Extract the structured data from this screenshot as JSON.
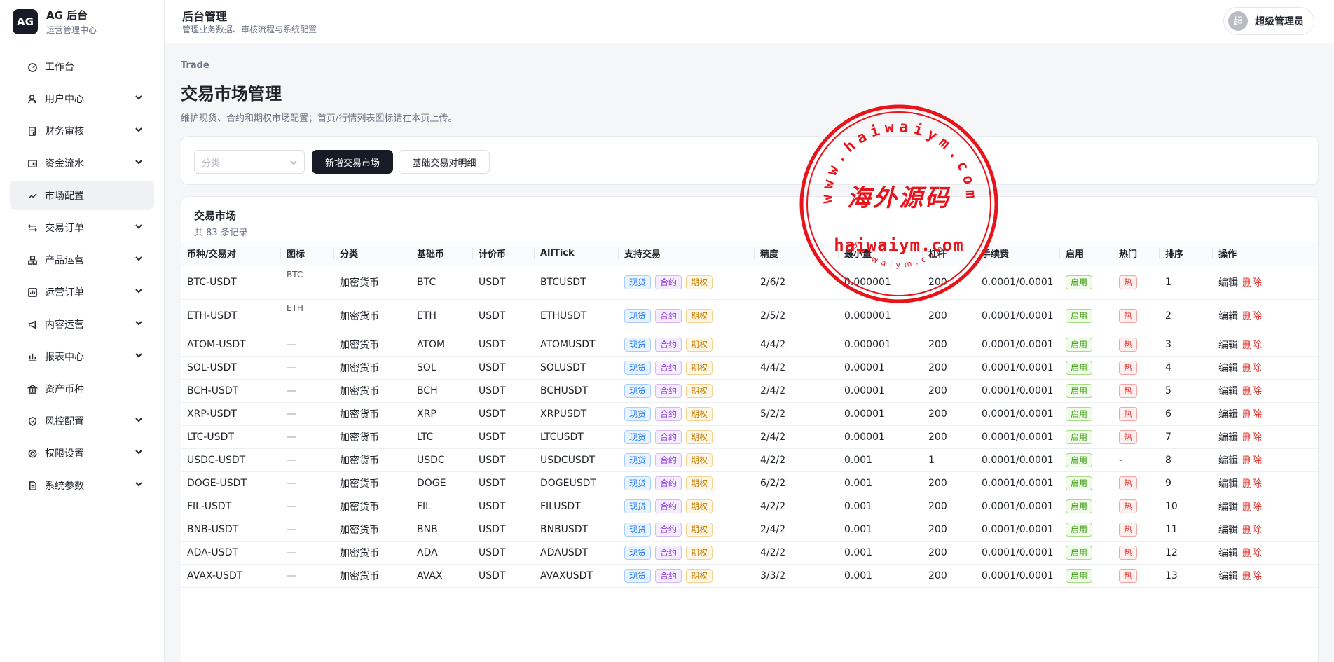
{
  "brand": {
    "logo": "AG",
    "title": "AG 后台",
    "subtitle": "运营管理中心"
  },
  "sidebar": {
    "items": [
      {
        "label": "工作台",
        "icon": "dashboard-icon",
        "expandable": false,
        "active": false
      },
      {
        "label": "用户中心",
        "icon": "user-icon",
        "expandable": true,
        "active": false
      },
      {
        "label": "财务审核",
        "icon": "audit-icon",
        "expandable": true,
        "active": false
      },
      {
        "label": "资金流水",
        "icon": "wallet-icon",
        "expandable": true,
        "active": false
      },
      {
        "label": "市场配置",
        "icon": "chart-line-icon",
        "expandable": false,
        "active": true
      },
      {
        "label": "交易订单",
        "icon": "swap-icon",
        "expandable": true,
        "active": false
      },
      {
        "label": "产品运营",
        "icon": "product-icon",
        "expandable": true,
        "active": false
      },
      {
        "label": "运营订单",
        "icon": "order-icon",
        "expandable": true,
        "active": false
      },
      {
        "label": "内容运营",
        "icon": "megaphone-icon",
        "expandable": true,
        "active": false
      },
      {
        "label": "报表中心",
        "icon": "bar-chart-icon",
        "expandable": true,
        "active": false
      },
      {
        "label": "资产币种",
        "icon": "bank-icon",
        "expandable": false,
        "active": false
      },
      {
        "label": "风控配置",
        "icon": "shield-icon",
        "expandable": true,
        "active": false
      },
      {
        "label": "权限设置",
        "icon": "gear-icon",
        "expandable": true,
        "active": false
      },
      {
        "label": "系统参数",
        "icon": "document-icon",
        "expandable": true,
        "active": false
      }
    ]
  },
  "topbar": {
    "title": "后台管理",
    "subtitle": "管理业务数据、审核流程与系统配置",
    "user_avatar": "超",
    "user_name": "超级管理员"
  },
  "page": {
    "eyebrow": "Trade",
    "title": "交易市场管理",
    "description": "维护现货、合约和期权市场配置；首页/行情列表图标请在本页上传。"
  },
  "filters": {
    "category_placeholder": "分类",
    "add_button": "新增交易市场",
    "pair_detail_button": "基础交易对明细"
  },
  "table": {
    "title": "交易市场",
    "count": "共 83 条记录",
    "columns": [
      "币种/交易对",
      "图标",
      "分类",
      "基础币",
      "计价币",
      "AllTick",
      "支持交易",
      "精度",
      "最小量",
      "杠杆",
      "手续费",
      "启用",
      "热门",
      "排序",
      "操作"
    ],
    "trade_tags": {
      "spot": "现货",
      "futures": "合约",
      "options": "期权"
    },
    "enabled_label": "启用",
    "hot_label": "热",
    "edit_label": "编辑",
    "delete_label": "删除",
    "rows": [
      {
        "pair": "BTC-USDT",
        "icon": "BTC",
        "category": "加密货币",
        "base": "BTC",
        "quote": "USDT",
        "alltick": "BTCUSDT",
        "precision": "2/6/2",
        "min_qty": "0.000001",
        "leverage": "200",
        "fee": "0.0001/0.0001",
        "hot": true,
        "sort": "1"
      },
      {
        "pair": "ETH-USDT",
        "icon": "ETH",
        "category": "加密货币",
        "base": "ETH",
        "quote": "USDT",
        "alltick": "ETHUSDT",
        "precision": "2/5/2",
        "min_qty": "0.000001",
        "leverage": "200",
        "fee": "0.0001/0.0001",
        "hot": true,
        "sort": "2"
      },
      {
        "pair": "ATOM-USDT",
        "icon": "—",
        "category": "加密货币",
        "base": "ATOM",
        "quote": "USDT",
        "alltick": "ATOMUSDT",
        "precision": "4/4/2",
        "min_qty": "0.000001",
        "leverage": "200",
        "fee": "0.0001/0.0001",
        "hot": true,
        "sort": "3"
      },
      {
        "pair": "SOL-USDT",
        "icon": "—",
        "category": "加密货币",
        "base": "SOL",
        "quote": "USDT",
        "alltick": "SOLUSDT",
        "precision": "4/4/2",
        "min_qty": "0.00001",
        "leverage": "200",
        "fee": "0.0001/0.0001",
        "hot": true,
        "sort": "4"
      },
      {
        "pair": "BCH-USDT",
        "icon": "—",
        "category": "加密货币",
        "base": "BCH",
        "quote": "USDT",
        "alltick": "BCHUSDT",
        "precision": "2/4/2",
        "min_qty": "0.00001",
        "leverage": "200",
        "fee": "0.0001/0.0001",
        "hot": true,
        "sort": "5"
      },
      {
        "pair": "XRP-USDT",
        "icon": "—",
        "category": "加密货币",
        "base": "XRP",
        "quote": "USDT",
        "alltick": "XRPUSDT",
        "precision": "5/2/2",
        "min_qty": "0.00001",
        "leverage": "200",
        "fee": "0.0001/0.0001",
        "hot": true,
        "sort": "6"
      },
      {
        "pair": "LTC-USDT",
        "icon": "—",
        "category": "加密货币",
        "base": "LTC",
        "quote": "USDT",
        "alltick": "LTCUSDT",
        "precision": "2/4/2",
        "min_qty": "0.00001",
        "leverage": "200",
        "fee": "0.0001/0.0001",
        "hot": true,
        "sort": "7"
      },
      {
        "pair": "USDC-USDT",
        "icon": "—",
        "category": "加密货币",
        "base": "USDC",
        "quote": "USDT",
        "alltick": "USDCUSDT",
        "precision": "4/2/2",
        "min_qty": "0.001",
        "leverage": "1",
        "fee": "0.0001/0.0001",
        "hot": false,
        "hot_text": "-",
        "sort": "8"
      },
      {
        "pair": "DOGE-USDT",
        "icon": "—",
        "category": "加密货币",
        "base": "DOGE",
        "quote": "USDT",
        "alltick": "DOGEUSDT",
        "precision": "6/2/2",
        "min_qty": "0.001",
        "leverage": "200",
        "fee": "0.0001/0.0001",
        "hot": true,
        "sort": "9"
      },
      {
        "pair": "FIL-USDT",
        "icon": "—",
        "category": "加密货币",
        "base": "FIL",
        "quote": "USDT",
        "alltick": "FILUSDT",
        "precision": "4/2/2",
        "min_qty": "0.001",
        "leverage": "200",
        "fee": "0.0001/0.0001",
        "hot": true,
        "sort": "10"
      },
      {
        "pair": "BNB-USDT",
        "icon": "—",
        "category": "加密货币",
        "base": "BNB",
        "quote": "USDT",
        "alltick": "BNBUSDT",
        "precision": "2/4/2",
        "min_qty": "0.001",
        "leverage": "200",
        "fee": "0.0001/0.0001",
        "hot": true,
        "sort": "11"
      },
      {
        "pair": "ADA-USDT",
        "icon": "—",
        "category": "加密货币",
        "base": "ADA",
        "quote": "USDT",
        "alltick": "ADAUSDT",
        "precision": "4/2/2",
        "min_qty": "0.001",
        "leverage": "200",
        "fee": "0.0001/0.0001",
        "hot": true,
        "sort": "12"
      },
      {
        "pair": "AVAX-USDT",
        "icon": "—",
        "category": "加密货币",
        "base": "AVAX",
        "quote": "USDT",
        "alltick": "AVAXUSDT",
        "precision": "3/3/2",
        "min_qty": "0.001",
        "leverage": "200",
        "fee": "0.0001/0.0001",
        "hot": true,
        "sort": "13"
      }
    ]
  },
  "watermark": {
    "top_arc": "www.haiwaiym.com",
    "center": "海外源码",
    "domain": "haiwaiym.com",
    "bottom_arc": "haiwaiym.com",
    "color": "#e8141b"
  },
  "colors": {
    "primary_button": "#161b26",
    "spot": "#1677ff",
    "futures": "#8c3fd9",
    "options": "#c87a00",
    "enabled": "#389e0d",
    "hot": "#e0342e"
  }
}
